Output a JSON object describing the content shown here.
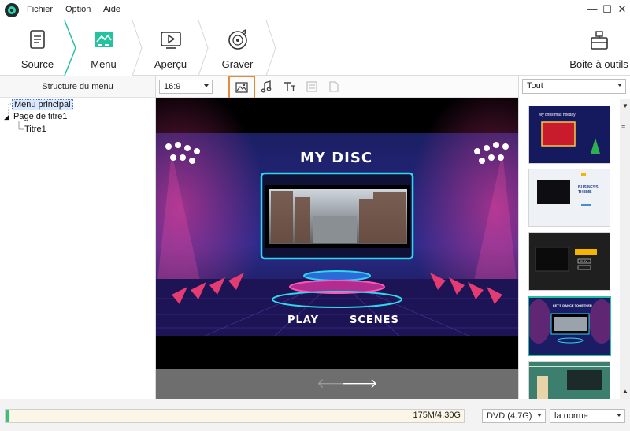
{
  "menubar": {
    "items": [
      "Fichier",
      "Option",
      "Aide"
    ]
  },
  "window_controls": {
    "minimize": "—",
    "maximize": "☐",
    "close": "✕"
  },
  "steps": [
    {
      "label": "Source",
      "icon": "source-icon"
    },
    {
      "label": "Menu",
      "icon": "menu-icon",
      "active": true
    },
    {
      "label": "Aperçu",
      "icon": "preview-icon"
    },
    {
      "label": "Graver",
      "icon": "burn-icon"
    }
  ],
  "toolbox": {
    "label": "Boite à outils",
    "icon": "toolbox-icon"
  },
  "left_panel": {
    "title": "Structure du menu",
    "tree": {
      "root": "Menu principal",
      "child": "Page de titre1",
      "grandchild": "Titre1"
    }
  },
  "center_toolbar": {
    "aspect_ratio": "16:9",
    "tools": [
      "background-image-icon",
      "music-icon",
      "text-icon",
      "chapter-icon",
      "copy-icon"
    ]
  },
  "preview": {
    "title": "MY DISC",
    "buttons": [
      "PLAY",
      "SCENES"
    ]
  },
  "right_panel": {
    "filter": "Tout",
    "templates": [
      {
        "caption": "My christmas holiday"
      },
      {
        "caption": "BUSINESS THEME"
      },
      {
        "caption": "PLAY"
      },
      {
        "caption": "LET'S DANCE TOGETHER"
      },
      {
        "caption": ""
      }
    ],
    "selected_index": 3
  },
  "bottom": {
    "capacity_text": "175M/4.30G",
    "capacity_fraction": 0.04,
    "disc_type": "DVD (4.7G)",
    "quality": "la norme"
  },
  "colors": {
    "accent": "#23c3a0",
    "highlight_border": "#e8893a",
    "tree_selected": "#dbe9ff"
  }
}
